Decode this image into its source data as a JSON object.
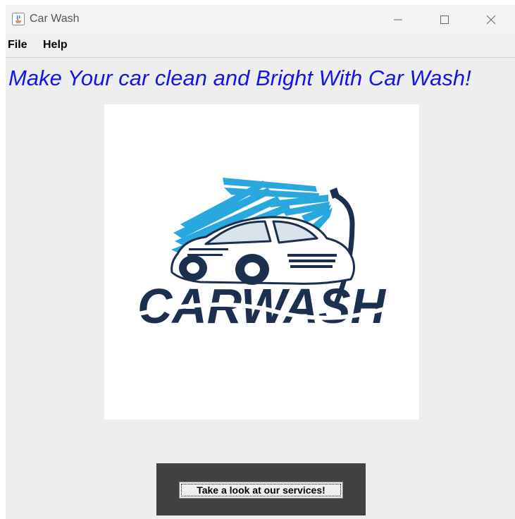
{
  "window": {
    "title": "Car Wash",
    "controls": {
      "minimize": "minimize-icon",
      "maximize": "maximize-icon",
      "close": "close-icon"
    }
  },
  "menubar": {
    "items": [
      "File",
      "Help"
    ]
  },
  "main": {
    "headline": "Make Your car clean and Bright With Car Wash!",
    "logo": {
      "wordmark": "CARWASH",
      "colors": {
        "blue": "#29a8df",
        "navy": "#1d2f4f"
      }
    },
    "cta_button": "Take a look at our services!"
  },
  "colors": {
    "headline": "#1515e6",
    "cta_panel": "#414141",
    "background": "#eeeeee"
  }
}
